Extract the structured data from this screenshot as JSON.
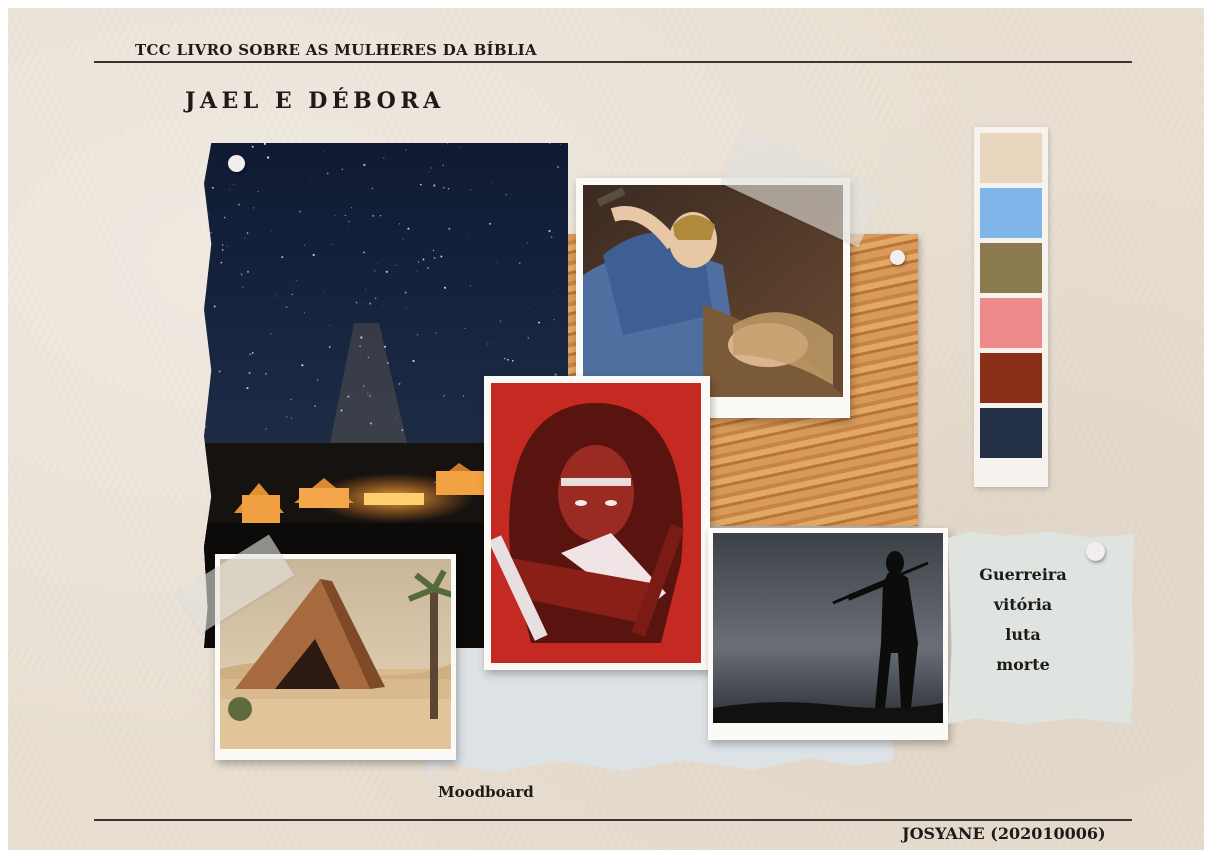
{
  "header": {
    "project_title": "TCC LIVRO SOBRE AS MULHERES DA BÍBLIA"
  },
  "board": {
    "title": "JAEL E DÉBORA",
    "caption": "Moodboard",
    "keywords": [
      "Guerreira",
      "vitória",
      "luta",
      "morte"
    ],
    "palette": [
      "#e9d6bf",
      "#7fb5e8",
      "#8a7a4e",
      "#ec8a8c",
      "#8a2e18",
      "#243046"
    ]
  },
  "footer": {
    "author": "JOSYANE (202010006)"
  },
  "colors": {
    "background": "#e9dfd2",
    "rule": "#3a3532"
  }
}
